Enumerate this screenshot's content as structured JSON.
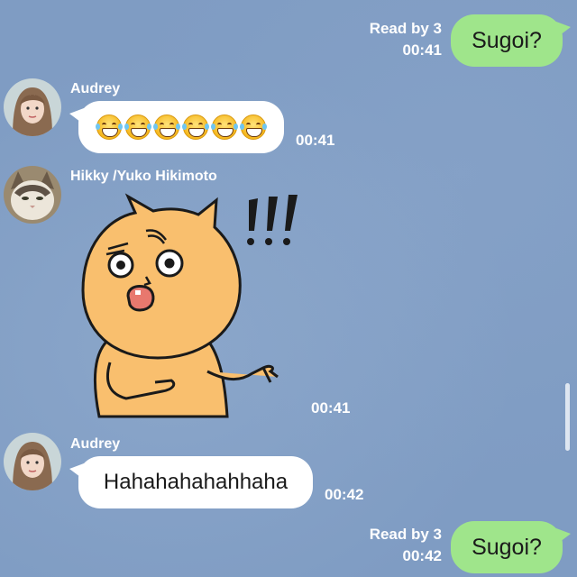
{
  "messages": {
    "out1": {
      "text": "Sugoi?",
      "read": "Read by 3",
      "time": "00:41"
    },
    "audrey1": {
      "sender": "Audrey",
      "emoji_count": 6,
      "emoji": "laughing-tears-emoji",
      "time": "00:41"
    },
    "hikky": {
      "sender": "Hikky /Yuko Hikimoto",
      "sticker": "shocked-cat-sticker",
      "exclaim": "!!!",
      "time": "00:41"
    },
    "audrey2": {
      "sender": "Audrey",
      "text": "Hahahahahahhaha",
      "time": "00:42"
    },
    "out2": {
      "text": "Sugoi?",
      "read": "Read by 3",
      "time": "00:42"
    }
  },
  "colors": {
    "background": "#7f9cc3",
    "outgoing_bubble": "#9fe58b",
    "incoming_bubble": "#ffffff",
    "sticker_fill": "#f9bf6e"
  }
}
